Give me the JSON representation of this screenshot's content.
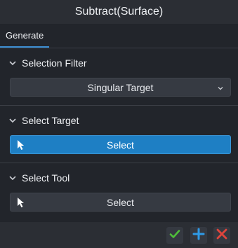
{
  "window": {
    "title": "Subtract(Surface)"
  },
  "tabs": [
    {
      "label": "Generate",
      "active": true
    }
  ],
  "sections": [
    {
      "title": "Selection Filter",
      "control": {
        "type": "dropdown",
        "value": "Singular Target"
      }
    },
    {
      "title": "Select Target",
      "control": {
        "type": "button",
        "label": "Select",
        "state": "active",
        "icon": "cursor-arrow-icon"
      }
    },
    {
      "title": "Select Tool",
      "control": {
        "type": "button",
        "label": "Select",
        "state": "normal",
        "icon": "cursor-arrow-icon"
      }
    }
  ],
  "footer": {
    "buttons": [
      {
        "name": "confirm",
        "icon": "check-icon",
        "color": "#4fbf3a"
      },
      {
        "name": "add",
        "icon": "plus-icon",
        "color": "#2f9be8"
      },
      {
        "name": "cancel",
        "icon": "x-icon",
        "color": "#e0453c"
      }
    ]
  },
  "colors": {
    "accent": "#1e7fc4",
    "background": "#22252b"
  }
}
